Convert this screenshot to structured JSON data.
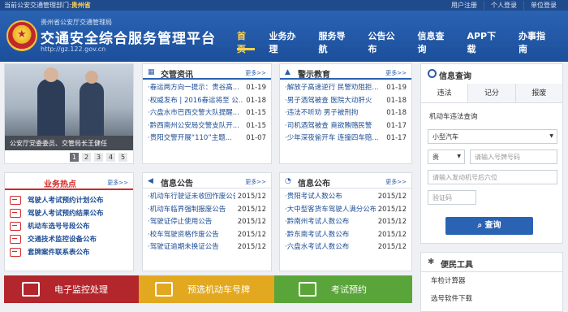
{
  "topbar": {
    "dept_prefix": "当前公安交通管理部门:",
    "dept_name": "贵州省",
    "links": [
      "用户注册",
      "个人登录",
      "单位登录"
    ]
  },
  "header": {
    "subtitle": "贵州省公安厅交通管理局",
    "title": "交通安全综合服务管理平台",
    "url": "http://gz.122.gov.cn"
  },
  "nav": [
    {
      "label": "首页",
      "active": true
    },
    {
      "label": "业务办理",
      "active": false
    },
    {
      "label": "服务导航",
      "active": false
    },
    {
      "label": "公告公布",
      "active": false
    },
    {
      "label": "信息查询",
      "active": false
    },
    {
      "label": "APP下载",
      "active": false
    },
    {
      "label": "办事指南",
      "active": false
    }
  ],
  "slideshow": {
    "caption": "公安厅党委委员、交管局长王健任",
    "pages": [
      "1",
      "2",
      "3",
      "4",
      "5"
    ]
  },
  "panels": {
    "traffic_news": {
      "title": "交管资讯",
      "more": "更多>>",
      "items": [
        {
          "text": "春运两方向一提示：贵谷高...",
          "date": "01-19"
        },
        {
          "text": "权威发布 | 2016春运将至 公...",
          "date": "01-18"
        },
        {
          "text": "六盘水市巴西交警大队提醒...",
          "date": "01-15"
        },
        {
          "text": "黔西南州公安局交警支队开...",
          "date": "01-15"
        },
        {
          "text": "贵阳交警开展“110”主题...",
          "date": "01-07"
        }
      ]
    },
    "warning_edu": {
      "title": "警示教育",
      "more": "更多>>",
      "items": [
        {
          "text": "解放子高速逆行 民警劝阻拒...",
          "date": "01-19"
        },
        {
          "text": "男子酒驾被查 医院大动肝火",
          "date": "01-18"
        },
        {
          "text": "违法不听劝 男子被刑拘",
          "date": "01-18"
        },
        {
          "text": "司机酒驾被查 竟欲贿赂民警",
          "date": "01-17"
        },
        {
          "text": "少年深夜偷开车 连撞四车赔...",
          "date": "01-17"
        }
      ]
    },
    "info_notice": {
      "title": "信息公告",
      "more": "更多>>",
      "items": [
        {
          "text": "机动车行驶证未收回作废公告",
          "date": "2015/12"
        },
        {
          "text": "机动车临界强制报废公告",
          "date": "2015/12"
        },
        {
          "text": "驾驶证停止使用公告",
          "date": "2015/12"
        },
        {
          "text": "校车驾驶资格作废公告",
          "date": "2015/12"
        },
        {
          "text": "驾驶证逾期未换证公告",
          "date": "2015/12"
        }
      ]
    },
    "info_publish": {
      "title": "信息公布",
      "more": "更多>>",
      "items": [
        {
          "text": "贵阳考试人数公布",
          "date": "2015/12"
        },
        {
          "text": "大中型客货车驾驶人满分公布",
          "date": "2015/12"
        },
        {
          "text": "黔南州考试人数公布",
          "date": "2015/12"
        },
        {
          "text": "黔东南考试人数公布",
          "date": "2015/12"
        },
        {
          "text": "六盘水考试人数公布",
          "date": "2015/12"
        }
      ]
    }
  },
  "hot": {
    "title": "业务热点",
    "more": "更多>>",
    "items": [
      "驾驶人考试预约计划公布",
      "驾驶人考试预约结果公布",
      "机动车选号号段公布",
      "交通技术监控设备公布",
      "套牌案件联系表公布"
    ]
  },
  "bottom_bars": [
    {
      "label": "电子监控处理",
      "color": "#b3262c",
      "icon": "camera-icon"
    },
    {
      "label": "预选机动车号牌",
      "color": "#e2a820",
      "icon": "plate-icon"
    },
    {
      "label": "考试预约",
      "color": "#5aa53a",
      "icon": "calendar-icon"
    }
  ],
  "query": {
    "title": "信息查询",
    "tabs": [
      "违法",
      "记分",
      "报废"
    ],
    "section_label": "机动车违法查询",
    "vehicle_type": "小型汽车",
    "province": "贵",
    "plate_placeholder": "请输入号牌号码",
    "engine_placeholder": "请输入发动机号后六位",
    "captcha_placeholder": "验证码",
    "button": "查询"
  },
  "tools": {
    "title": "便民工具",
    "items": [
      "车检计算器",
      "选号软件下载"
    ]
  }
}
